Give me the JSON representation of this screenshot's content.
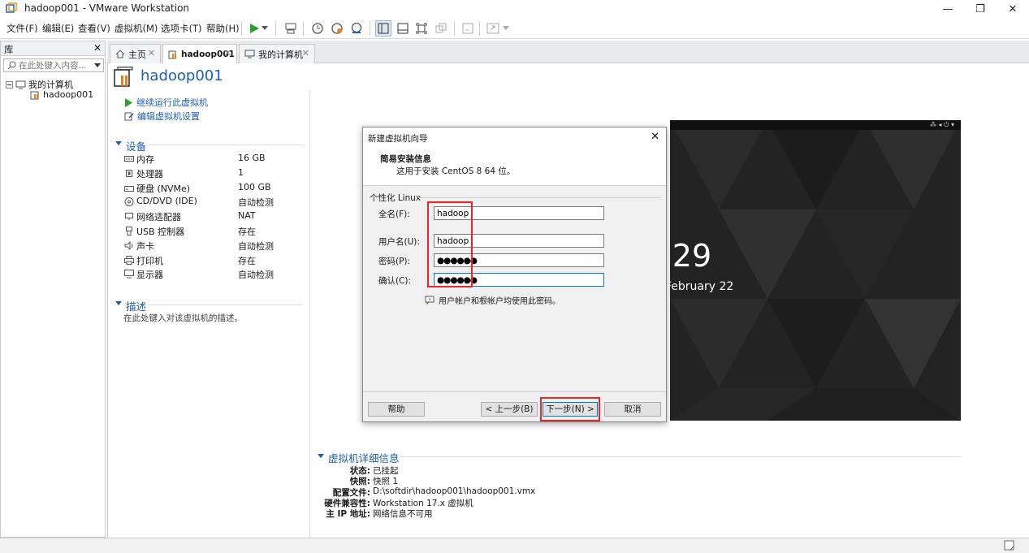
{
  "window": {
    "title": "hadoop001 - VMware Workstation",
    "controls": {
      "minimize": "—",
      "maximize": "❐",
      "close": "✕"
    }
  },
  "menubar": {
    "items": [
      "文件(F)",
      "编辑(E)",
      "查看(V)",
      "虚拟机(M)",
      "选项卡(T)",
      "帮助(H)"
    ]
  },
  "library": {
    "title": "库",
    "close": "✕",
    "search_placeholder": "在此处键入内容...",
    "tree": {
      "root": "我的计算机",
      "child": "hadoop001"
    }
  },
  "tabs": [
    {
      "label": "主页",
      "close": "✕"
    },
    {
      "label": "hadoop001",
      "close": "✕"
    },
    {
      "label": "我的计算机",
      "close": "✕"
    }
  ],
  "vm": {
    "name": "hadoop001",
    "actions": {
      "resume": "继续运行此虚拟机",
      "edit": "编辑虚拟机设置"
    },
    "devices_title": "设备",
    "devices": [
      {
        "name": "内存",
        "value": "16 GB",
        "icon": "memory-icon"
      },
      {
        "name": "处理器",
        "value": "1",
        "icon": "processor-icon"
      },
      {
        "name": "硬盘 (NVMe)",
        "value": "100 GB",
        "icon": "disk-icon"
      },
      {
        "name": "CD/DVD (IDE)",
        "value": "自动检测",
        "icon": "cd-icon"
      },
      {
        "name": "网络适配器",
        "value": "NAT",
        "icon": "network-icon"
      },
      {
        "name": "USB 控制器",
        "value": "存在",
        "icon": "usb-icon"
      },
      {
        "name": "声卡",
        "value": "自动检测",
        "icon": "sound-icon"
      },
      {
        "name": "打印机",
        "value": "存在",
        "icon": "printer-icon"
      },
      {
        "name": "显示器",
        "value": "自动检测",
        "icon": "display-icon"
      }
    ],
    "description_title": "描述",
    "description_placeholder": "在此处键入对该虚拟机的描述。",
    "screen": {
      "clock": ":29",
      "date": "February 22"
    },
    "details_title": "虚拟机详细信息",
    "details": [
      {
        "key": "状态:",
        "value": "已挂起"
      },
      {
        "key": "快照:",
        "value": "快照 1"
      },
      {
        "key": "配置文件:",
        "value": "D:\\softdir\\hadoop001\\hadoop001.vmx"
      },
      {
        "key": "硬件兼容性:",
        "value": "Workstation 17.x 虚拟机"
      },
      {
        "key": "主 IP 地址:",
        "value": "网络信息不可用"
      }
    ]
  },
  "dialog": {
    "title": "新建虚拟机向导",
    "close": "✕",
    "heading": "简易安装信息",
    "subheading": "这用于安装 CentOS 8 64 位。",
    "group_label": "个性化 Linux",
    "fields": {
      "fullname": {
        "label": "全名(F):",
        "value": "hadoop"
      },
      "username": {
        "label": "用户名(U):",
        "value": "hadoop"
      },
      "password": {
        "label": "密码(P):",
        "value": "●●●●●●"
      },
      "confirm": {
        "label": "确认(C):",
        "value": "●●●●●●"
      }
    },
    "note": "用户帐户和根帐户均使用此密码。",
    "buttons": {
      "help": "帮助",
      "back": "< 上一步(B)",
      "next": "下一步(N) >",
      "cancel": "取消"
    }
  },
  "colors": {
    "accent": "#1c5fb0",
    "highlight": "#e8262b",
    "play": "#2aa02a"
  }
}
